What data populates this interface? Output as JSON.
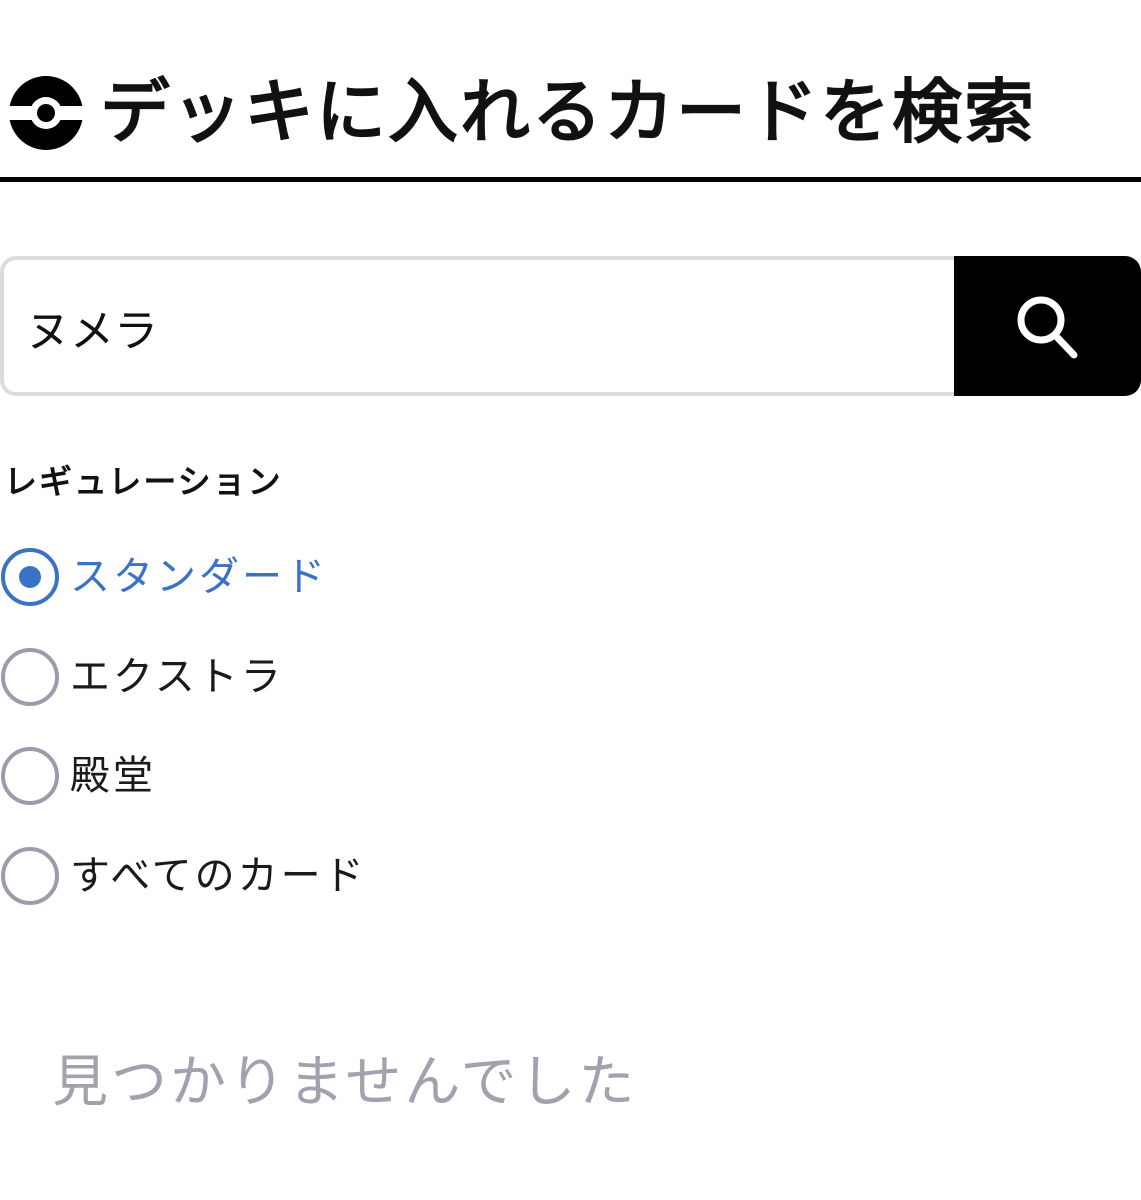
{
  "header": {
    "icon": "pokeball-icon",
    "title": "デッキに入れるカードを検索"
  },
  "search": {
    "value": "ヌメラ",
    "button_icon": "search-icon"
  },
  "regulation": {
    "label": "レギュレーション",
    "options": [
      {
        "label": "スタンダード",
        "selected": true
      },
      {
        "label": "エクストラ",
        "selected": false
      },
      {
        "label": "殿堂",
        "selected": false
      },
      {
        "label": "すべてのカード",
        "selected": false
      }
    ]
  },
  "results": {
    "empty_message": "見つかりませんでした"
  },
  "colors": {
    "accent": "#3a72c4",
    "radio_border": "#9d9aaa",
    "muted_text": "#a4a1ae",
    "header_rule": "#000000"
  }
}
